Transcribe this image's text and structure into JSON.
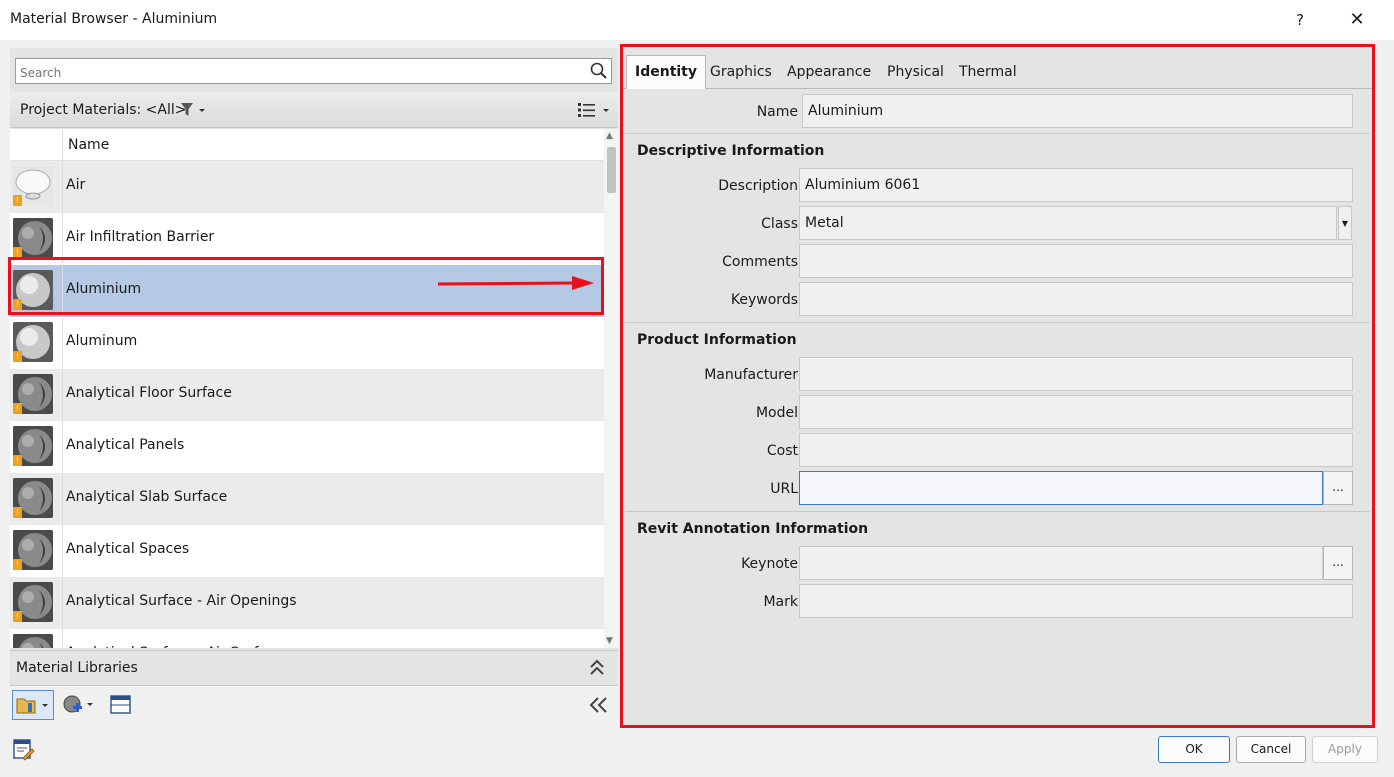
{
  "window": {
    "title": "Material Browser - Aluminium",
    "help": "?",
    "close": "✕"
  },
  "search": {
    "placeholder": "Search"
  },
  "project_bar": {
    "label": "Project Materials: <All>"
  },
  "list": {
    "column_header": "Name",
    "items": [
      {
        "name": "Air",
        "icon": "air-material-icon",
        "selected": false
      },
      {
        "name": "Air Infiltration Barrier",
        "icon": "material-sphere-icon",
        "selected": false
      },
      {
        "name": "Aluminium",
        "icon": "metal-sphere-icon",
        "selected": true
      },
      {
        "name": "Aluminum",
        "icon": "metal-sphere-icon",
        "selected": false
      },
      {
        "name": "Analytical Floor Surface",
        "icon": "material-sphere-icon",
        "selected": false
      },
      {
        "name": "Analytical Panels",
        "icon": "material-sphere-icon",
        "selected": false
      },
      {
        "name": "Analytical Slab Surface",
        "icon": "material-sphere-icon",
        "selected": false
      },
      {
        "name": "Analytical Spaces",
        "icon": "material-sphere-icon",
        "selected": false
      },
      {
        "name": "Analytical Surface - Air Openings",
        "icon": "material-sphere-icon",
        "selected": false
      },
      {
        "name": "Analytical Surface - Air Surface",
        "icon": "material-sphere-icon",
        "selected": false
      }
    ]
  },
  "libraries": {
    "label": "Material Libraries"
  },
  "tabs": [
    "Identity",
    "Graphics",
    "Appearance",
    "Physical",
    "Thermal"
  ],
  "identity": {
    "name_label": "Name",
    "name_value": "Aluminium",
    "descriptive": {
      "title": "Descriptive Information",
      "description_label": "Description",
      "description_value": "Aluminium 6061",
      "class_label": "Class",
      "class_value": "Metal",
      "comments_label": "Comments",
      "comments_value": "",
      "keywords_label": "Keywords",
      "keywords_value": ""
    },
    "product": {
      "title": "Product Information",
      "manufacturer_label": "Manufacturer",
      "manufacturer_value": "",
      "model_label": "Model",
      "model_value": "",
      "cost_label": "Cost",
      "cost_value": "",
      "url_label": "URL",
      "url_value": "",
      "url_button": "..."
    },
    "revit": {
      "title": "Revit Annotation Information",
      "keynote_label": "Keynote",
      "keynote_value": "",
      "keynote_button": "...",
      "mark_label": "Mark",
      "mark_value": ""
    }
  },
  "buttons": {
    "ok": "OK",
    "cancel": "Cancel",
    "apply": "Apply"
  },
  "colors": {
    "highlight": "#e8101a",
    "selection": "#b6c9e4",
    "focus": "#3c78c8"
  }
}
